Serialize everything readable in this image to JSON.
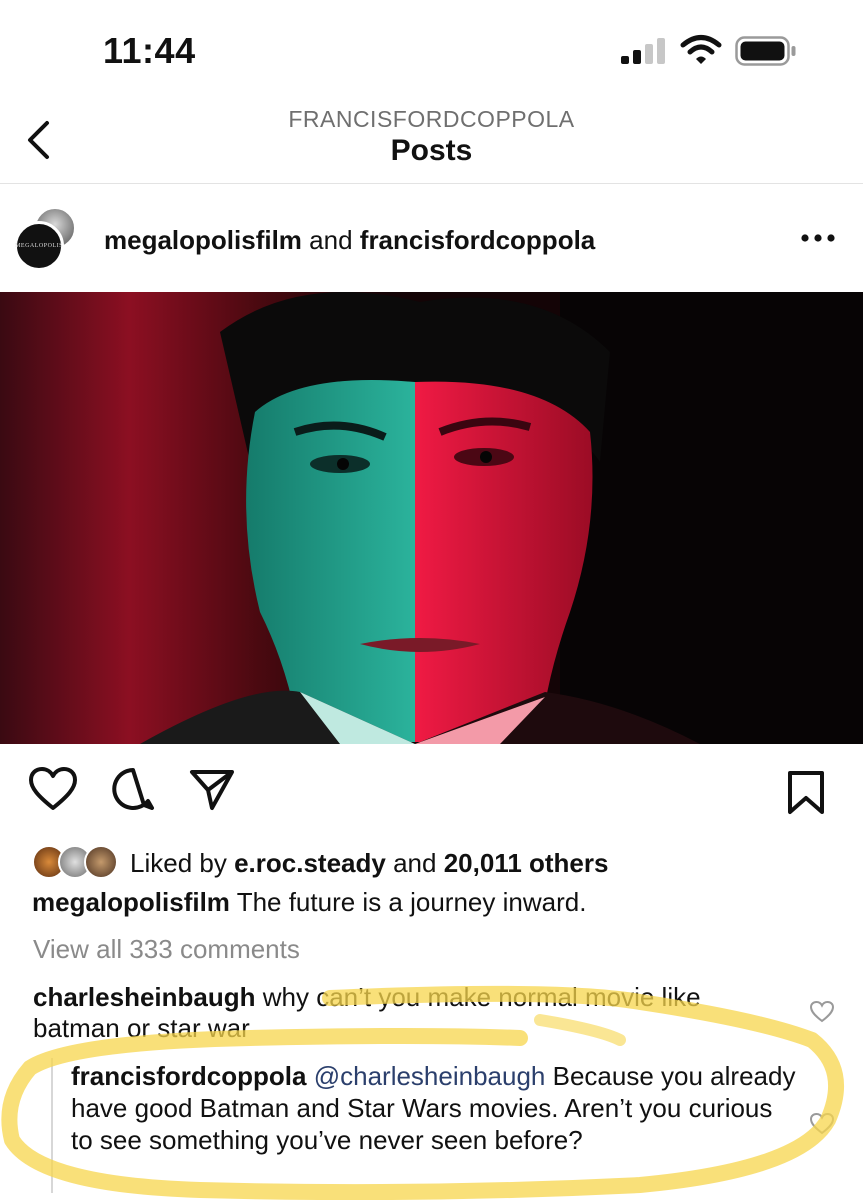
{
  "status_bar": {
    "time": "11:44",
    "icons": [
      "cellular-signal-icon",
      "wifi-icon",
      "battery-icon"
    ]
  },
  "header": {
    "subtitle": "FRANCISFORDCOPPOLA",
    "title": "Posts",
    "back_icon": "chevron-left-icon"
  },
  "post": {
    "author_primary": "megalopolisfilm",
    "author_joiner": "and",
    "author_secondary": "francisfordcoppola",
    "avatar_logo_text": "MEGALOPOLIS",
    "more_icon": "more-horizontal-icon",
    "image_description_icon": "post-photo",
    "actions": [
      "heart-icon",
      "comment-icon",
      "share-icon",
      "bookmark-icon"
    ],
    "likes": {
      "prefix": "Liked by",
      "user": "e.roc.steady",
      "joiner": "and",
      "count": "20,011 others"
    },
    "caption": {
      "user": "megalopolisfilm",
      "text": "The future is a journey inward."
    },
    "view_all": "View all 333 comments",
    "comments": [
      {
        "user": "charlesheinbaugh",
        "text": "why can’t you make normal movie like batman or star war"
      }
    ],
    "reply": {
      "user": "francisfordcoppola",
      "mention": "@charlesheinbaugh",
      "text": "Because you already have good Batman and Star Wars movies. Aren’t you curious  to see something you’ve never seen before?"
    }
  },
  "colors": {
    "text": "#111111",
    "muted": "#8a8a8a",
    "mention": "#2b3f6c",
    "highlight": "#f7d64c",
    "image_left": "#1fa893",
    "image_right": "#e8163e"
  }
}
